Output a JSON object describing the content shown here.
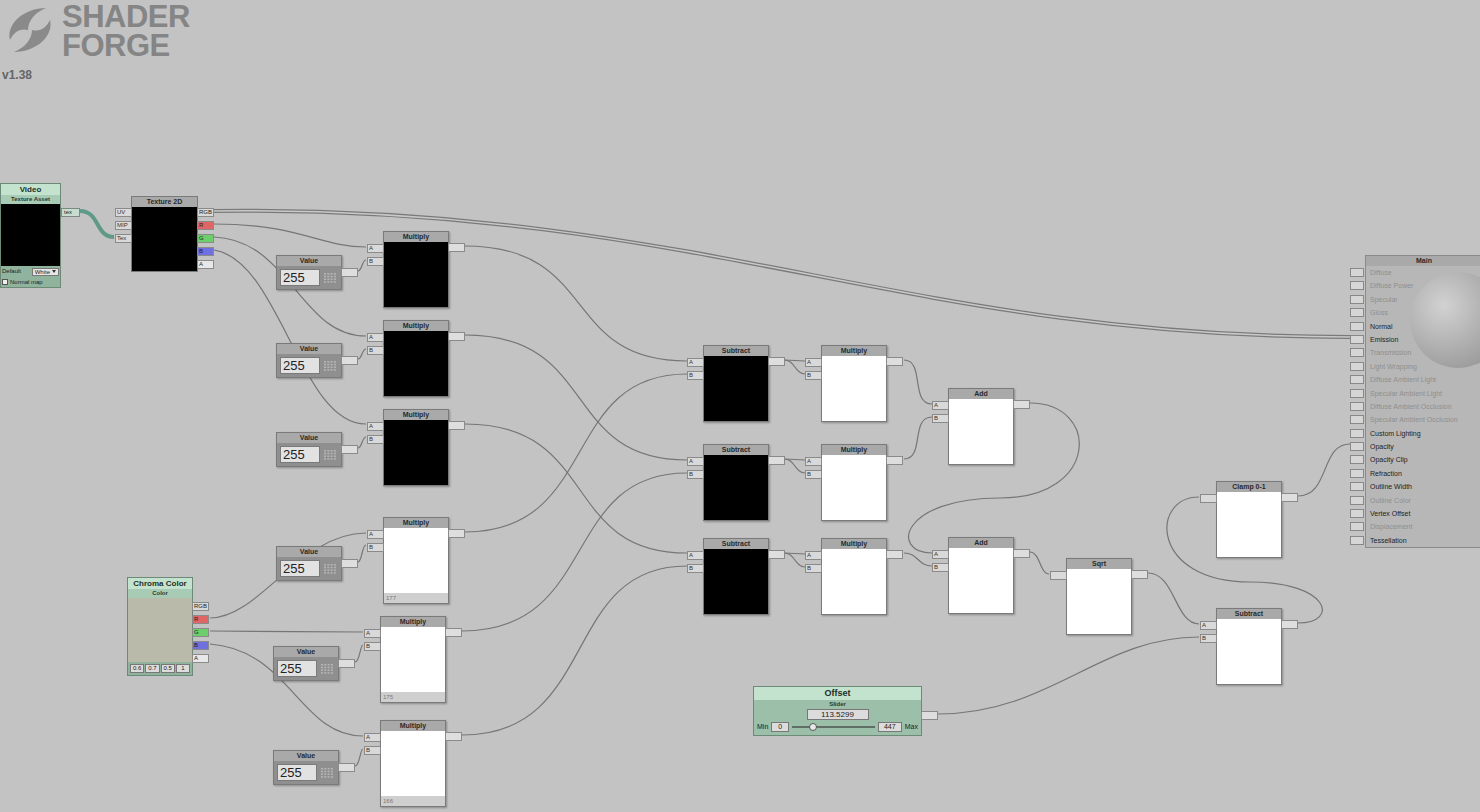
{
  "logo": {
    "line1": "SHADER",
    "line2": "FORGE",
    "version": "v1.38"
  },
  "video": {
    "title": "Video",
    "subtitle": "Texture Asset",
    "output": "tex",
    "default_label": "Default",
    "default_value": "White",
    "normal_map": {
      "label": "Normal map",
      "checked": false
    }
  },
  "texture2d": {
    "title": "Texture 2D",
    "inputs": [
      "UV",
      "MIP",
      "Tex"
    ],
    "outputs": [
      {
        "label": "RGB",
        "color": "#d9d9d9"
      },
      {
        "label": "R",
        "color": "#e06666"
      },
      {
        "label": "G",
        "color": "#6ccf6c"
      },
      {
        "label": "B",
        "color": "#6f6fe0"
      },
      {
        "label": "A",
        "color": "#e8e8e8"
      }
    ]
  },
  "values": [
    {
      "title": "Value",
      "value": "255"
    },
    {
      "title": "Value",
      "value": "255"
    },
    {
      "title": "Value",
      "value": "255"
    },
    {
      "title": "Value",
      "value": "255"
    },
    {
      "title": "Value",
      "value": "255"
    },
    {
      "title": "Value",
      "value": "255"
    }
  ],
  "operators": [
    {
      "title": "Multiply",
      "inputs": [
        "A",
        "B"
      ],
      "preview": "#000000"
    },
    {
      "title": "Multiply",
      "inputs": [
        "A",
        "B"
      ],
      "preview": "#000000"
    },
    {
      "title": "Multiply",
      "inputs": [
        "A",
        "B"
      ],
      "preview": "#000000"
    },
    {
      "title": "Multiply",
      "inputs": [
        "A",
        "B"
      ],
      "preview": "#ffffff",
      "footer": "177"
    },
    {
      "title": "Multiply",
      "inputs": [
        "A",
        "B"
      ],
      "preview": "#ffffff",
      "footer": "175"
    },
    {
      "title": "Multiply",
      "inputs": [
        "A",
        "B"
      ],
      "preview": "#ffffff",
      "footer": "166"
    },
    {
      "title": "Subtract",
      "inputs": [
        "A",
        "B"
      ],
      "preview": "#000000"
    },
    {
      "title": "Subtract",
      "inputs": [
        "A",
        "B"
      ],
      "preview": "#000000"
    },
    {
      "title": "Subtract",
      "inputs": [
        "A",
        "B"
      ],
      "preview": "#000000"
    },
    {
      "title": "Multiply",
      "inputs": [
        "A",
        "B"
      ],
      "preview": "#ffffff"
    },
    {
      "title": "Multiply",
      "inputs": [
        "A",
        "B"
      ],
      "preview": "#ffffff"
    },
    {
      "title": "Multiply",
      "inputs": [
        "A",
        "B"
      ],
      "preview": "#ffffff"
    },
    {
      "title": "Add",
      "inputs": [
        "A",
        "B"
      ],
      "preview": "#ffffff"
    },
    {
      "title": "Add",
      "inputs": [
        "A",
        "B"
      ],
      "preview": "#ffffff"
    },
    {
      "title": "Sqrt",
      "inputs": [
        ""
      ],
      "preview": "#ffffff"
    },
    {
      "title": "Clamp 0-1",
      "inputs": [
        ""
      ],
      "preview": "#ffffff"
    },
    {
      "title": "Subtract",
      "inputs": [
        "A",
        "B"
      ],
      "preview": "#ffffff"
    }
  ],
  "chroma": {
    "title": "Chroma Color",
    "subtitle": "Color",
    "color": "#b9baa9",
    "outputs": [
      {
        "label": "RGB",
        "color": "#d9d9d9"
      },
      {
        "label": "R",
        "color": "#e06666"
      },
      {
        "label": "G",
        "color": "#6ccf6c"
      },
      {
        "label": "B",
        "color": "#6f6fe0"
      },
      {
        "label": "A",
        "color": "#e8e8e8"
      }
    ],
    "components": [
      "0.6",
      "0.7",
      "0.5",
      "1"
    ]
  },
  "slider": {
    "title": "Offset",
    "subtitle": "Slider",
    "value": "113.5299",
    "min_label": "Min",
    "min": "0",
    "max": "447",
    "max_label": "Max",
    "level": 0.254
  },
  "main": {
    "title": "Main",
    "inputs": [
      {
        "label": "Diffuse",
        "enabled": false
      },
      {
        "label": "Diffuse Power",
        "enabled": false
      },
      {
        "label": "Specular",
        "enabled": false
      },
      {
        "label": "Gloss",
        "enabled": false
      },
      {
        "label": "Normal",
        "enabled": true
      },
      {
        "label": "Emission",
        "enabled": true
      },
      {
        "label": "Transmission",
        "enabled": false
      },
      {
        "label": "Light Wrapping",
        "enabled": false
      },
      {
        "label": "Diffuse Ambient Light",
        "enabled": false
      },
      {
        "label": "Specular Ambient Light",
        "enabled": false
      },
      {
        "label": "Diffuse Ambient Occlusion",
        "enabled": false
      },
      {
        "label": "Specular Ambient Occlusion",
        "enabled": false
      },
      {
        "label": "Custom Lighting",
        "enabled": true
      },
      {
        "label": "Opacity",
        "enabled": true
      },
      {
        "label": "Opacity Clip",
        "enabled": true
      },
      {
        "label": "Refraction",
        "enabled": true
      },
      {
        "label": "Outline Width",
        "enabled": true
      },
      {
        "label": "Outline Color",
        "enabled": false
      },
      {
        "label": "Vertex Offset",
        "enabled": true
      },
      {
        "label": "Displacement",
        "enabled": false
      },
      {
        "label": "Tessellation",
        "enabled": true
      }
    ]
  }
}
